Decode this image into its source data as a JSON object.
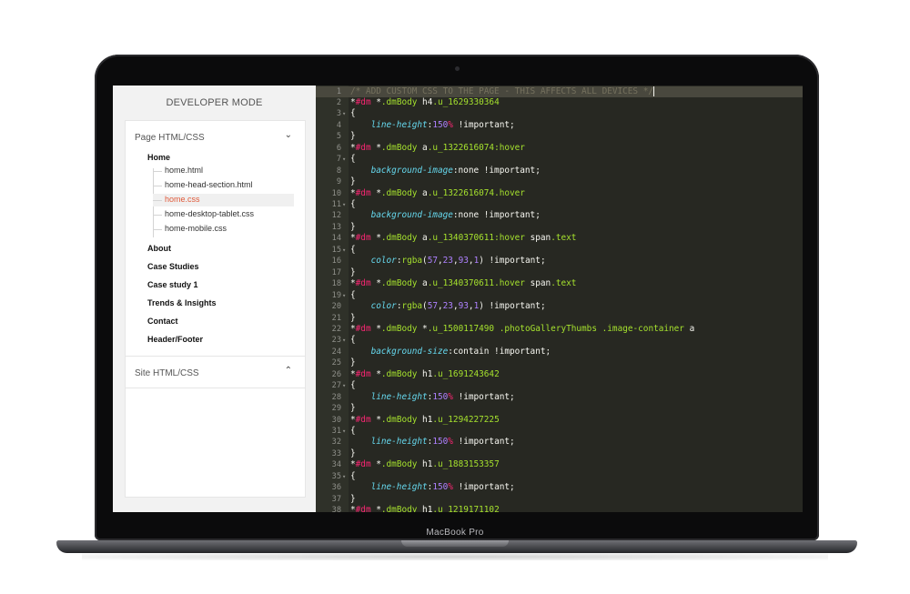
{
  "device": {
    "brand_label": "MacBook Pro"
  },
  "sidebar": {
    "title": "DEVELOPER MODE",
    "section_page": {
      "label": "Page HTML/CSS",
      "icon": "chevron-down-icon"
    },
    "pages": [
      "Home",
      "About",
      "Case Studies",
      "Case study 1",
      "Trends & Insights",
      "Contact",
      "Header/Footer"
    ],
    "home_files": [
      "home.html",
      "home-head-section.html",
      "home.css",
      "home-desktop-tablet.css",
      "home-mobile.css"
    ],
    "active_file": "home.css",
    "section_site": {
      "label": "Site HTML/CSS",
      "icon": "chevron-up-icon"
    }
  },
  "editor": {
    "colors": {
      "background": "#272822",
      "comment": "#75715e",
      "tag": "#f92672",
      "class": "#a6e22e",
      "property": "#66d9ef",
      "number": "#ae81ff",
      "text": "#f8f8f2"
    },
    "lines": [
      {
        "n": "1",
        "fold": "",
        "hl": true,
        "tokens": [
          [
            "cm",
            "/* ADD CUSTOM CSS TO THE PAGE - THIS AFFECTS ALL DEVICES */"
          ]
        ]
      },
      {
        "n": "2",
        "fold": "",
        "tokens": [
          [
            "w",
            "*"
          ],
          [
            "k",
            "#dm"
          ],
          [
            "w",
            " *"
          ],
          [
            "c",
            ".dmBody"
          ],
          [
            "w",
            " h4"
          ],
          [
            "c",
            ".u_1629330364"
          ]
        ]
      },
      {
        "n": "3",
        "fold": "▾",
        "tokens": [
          [
            "w",
            "{"
          ]
        ]
      },
      {
        "n": "4",
        "fold": "",
        "tokens": [
          [
            "w",
            "    "
          ],
          [
            "p",
            "line-height"
          ],
          [
            "w",
            ":"
          ],
          [
            "n",
            "150"
          ],
          [
            "u",
            "%"
          ],
          [
            "w",
            " !important;"
          ]
        ]
      },
      {
        "n": "5",
        "fold": "",
        "tokens": [
          [
            "w",
            "}"
          ]
        ]
      },
      {
        "n": "6",
        "fold": "",
        "tokens": [
          [
            "w",
            "*"
          ],
          [
            "k",
            "#dm"
          ],
          [
            "w",
            " *"
          ],
          [
            "c",
            ".dmBody"
          ],
          [
            "w",
            " a"
          ],
          [
            "c",
            ".u_1322616074:hover"
          ]
        ]
      },
      {
        "n": "7",
        "fold": "▾",
        "tokens": [
          [
            "w",
            "{"
          ]
        ]
      },
      {
        "n": "8",
        "fold": "",
        "tokens": [
          [
            "w",
            "    "
          ],
          [
            "p",
            "background-image"
          ],
          [
            "w",
            ":none !important;"
          ]
        ]
      },
      {
        "n": "9",
        "fold": "",
        "tokens": [
          [
            "w",
            "}"
          ]
        ]
      },
      {
        "n": "10",
        "fold": "",
        "tokens": [
          [
            "w",
            "*"
          ],
          [
            "k",
            "#dm"
          ],
          [
            "w",
            " *"
          ],
          [
            "c",
            ".dmBody"
          ],
          [
            "w",
            " a"
          ],
          [
            "c",
            ".u_1322616074.hover"
          ]
        ]
      },
      {
        "n": "11",
        "fold": "▾",
        "tokens": [
          [
            "w",
            "{"
          ]
        ]
      },
      {
        "n": "12",
        "fold": "",
        "tokens": [
          [
            "w",
            "    "
          ],
          [
            "p",
            "background-image"
          ],
          [
            "w",
            ":none !important;"
          ]
        ]
      },
      {
        "n": "13",
        "fold": "",
        "tokens": [
          [
            "w",
            "}"
          ]
        ]
      },
      {
        "n": "14",
        "fold": "",
        "tokens": [
          [
            "w",
            "*"
          ],
          [
            "k",
            "#dm"
          ],
          [
            "w",
            " *"
          ],
          [
            "c",
            ".dmBody"
          ],
          [
            "w",
            " a"
          ],
          [
            "c",
            ".u_1340370611:hover"
          ],
          [
            "w",
            " span"
          ],
          [
            "c",
            ".text"
          ]
        ]
      },
      {
        "n": "15",
        "fold": "▾",
        "tokens": [
          [
            "w",
            "{"
          ]
        ]
      },
      {
        "n": "16",
        "fold": "",
        "tokens": [
          [
            "w",
            "    "
          ],
          [
            "p",
            "color"
          ],
          [
            "w",
            ":"
          ],
          [
            "c",
            "rgba"
          ],
          [
            "w",
            "("
          ],
          [
            "n",
            "57"
          ],
          [
            "w",
            ","
          ],
          [
            "n",
            "23"
          ],
          [
            "w",
            ","
          ],
          [
            "n",
            "93"
          ],
          [
            "w",
            ","
          ],
          [
            "n",
            "1"
          ],
          [
            "w",
            ") !important;"
          ]
        ]
      },
      {
        "n": "17",
        "fold": "",
        "tokens": [
          [
            "w",
            "}"
          ]
        ]
      },
      {
        "n": "18",
        "fold": "",
        "tokens": [
          [
            "w",
            "*"
          ],
          [
            "k",
            "#dm"
          ],
          [
            "w",
            " *"
          ],
          [
            "c",
            ".dmBody"
          ],
          [
            "w",
            " a"
          ],
          [
            "c",
            ".u_1340370611.hover"
          ],
          [
            "w",
            " span"
          ],
          [
            "c",
            ".text"
          ]
        ]
      },
      {
        "n": "19",
        "fold": "▾",
        "tokens": [
          [
            "w",
            "{"
          ]
        ]
      },
      {
        "n": "20",
        "fold": "",
        "tokens": [
          [
            "w",
            "    "
          ],
          [
            "p",
            "color"
          ],
          [
            "w",
            ":"
          ],
          [
            "c",
            "rgba"
          ],
          [
            "w",
            "("
          ],
          [
            "n",
            "57"
          ],
          [
            "w",
            ","
          ],
          [
            "n",
            "23"
          ],
          [
            "w",
            ","
          ],
          [
            "n",
            "93"
          ],
          [
            "w",
            ","
          ],
          [
            "n",
            "1"
          ],
          [
            "w",
            ") !important;"
          ]
        ]
      },
      {
        "n": "21",
        "fold": "",
        "tokens": [
          [
            "w",
            "}"
          ]
        ]
      },
      {
        "n": "22",
        "fold": "",
        "tokens": [
          [
            "w",
            "*"
          ],
          [
            "k",
            "#dm"
          ],
          [
            "w",
            " *"
          ],
          [
            "c",
            ".dmBody"
          ],
          [
            "w",
            " *"
          ],
          [
            "c",
            ".u_1500117490"
          ],
          [
            "w",
            " "
          ],
          [
            "c",
            ".photoGalleryThumbs"
          ],
          [
            "w",
            " "
          ],
          [
            "c",
            ".image-container"
          ],
          [
            "w",
            " a"
          ]
        ]
      },
      {
        "n": "23",
        "fold": "▾",
        "tokens": [
          [
            "w",
            "{"
          ]
        ]
      },
      {
        "n": "24",
        "fold": "",
        "tokens": [
          [
            "w",
            "    "
          ],
          [
            "p",
            "background-size"
          ],
          [
            "w",
            ":contain !important;"
          ]
        ]
      },
      {
        "n": "25",
        "fold": "",
        "tokens": [
          [
            "w",
            "}"
          ]
        ]
      },
      {
        "n": "26",
        "fold": "",
        "tokens": [
          [
            "w",
            "*"
          ],
          [
            "k",
            "#dm"
          ],
          [
            "w",
            " *"
          ],
          [
            "c",
            ".dmBody"
          ],
          [
            "w",
            " h1"
          ],
          [
            "c",
            ".u_1691243642"
          ]
        ]
      },
      {
        "n": "27",
        "fold": "▾",
        "tokens": [
          [
            "w",
            "{"
          ]
        ]
      },
      {
        "n": "28",
        "fold": "",
        "tokens": [
          [
            "w",
            "    "
          ],
          [
            "p",
            "line-height"
          ],
          [
            "w",
            ":"
          ],
          [
            "n",
            "150"
          ],
          [
            "u",
            "%"
          ],
          [
            "w",
            " !important;"
          ]
        ]
      },
      {
        "n": "29",
        "fold": "",
        "tokens": [
          [
            "w",
            "}"
          ]
        ]
      },
      {
        "n": "30",
        "fold": "",
        "tokens": [
          [
            "w",
            "*"
          ],
          [
            "k",
            "#dm"
          ],
          [
            "w",
            " *"
          ],
          [
            "c",
            ".dmBody"
          ],
          [
            "w",
            " h1"
          ],
          [
            "c",
            ".u_1294227225"
          ]
        ]
      },
      {
        "n": "31",
        "fold": "▾",
        "tokens": [
          [
            "w",
            "{"
          ]
        ]
      },
      {
        "n": "32",
        "fold": "",
        "tokens": [
          [
            "w",
            "    "
          ],
          [
            "p",
            "line-height"
          ],
          [
            "w",
            ":"
          ],
          [
            "n",
            "150"
          ],
          [
            "u",
            "%"
          ],
          [
            "w",
            " !important;"
          ]
        ]
      },
      {
        "n": "33",
        "fold": "",
        "tokens": [
          [
            "w",
            "}"
          ]
        ]
      },
      {
        "n": "34",
        "fold": "",
        "tokens": [
          [
            "w",
            "*"
          ],
          [
            "k",
            "#dm"
          ],
          [
            "w",
            " *"
          ],
          [
            "c",
            ".dmBody"
          ],
          [
            "w",
            " h1"
          ],
          [
            "c",
            ".u_1883153357"
          ]
        ]
      },
      {
        "n": "35",
        "fold": "▾",
        "tokens": [
          [
            "w",
            "{"
          ]
        ]
      },
      {
        "n": "36",
        "fold": "",
        "tokens": [
          [
            "w",
            "    "
          ],
          [
            "p",
            "line-height"
          ],
          [
            "w",
            ":"
          ],
          [
            "n",
            "150"
          ],
          [
            "u",
            "%"
          ],
          [
            "w",
            " !important;"
          ]
        ]
      },
      {
        "n": "37",
        "fold": "",
        "tokens": [
          [
            "w",
            "}"
          ]
        ]
      },
      {
        "n": "38",
        "fold": "",
        "tokens": [
          [
            "w",
            "*"
          ],
          [
            "k",
            "#dm"
          ],
          [
            "w",
            " *"
          ],
          [
            "c",
            ".dmBody"
          ],
          [
            "w",
            " h1"
          ],
          [
            "c",
            ".u_1219171102"
          ]
        ]
      }
    ]
  }
}
